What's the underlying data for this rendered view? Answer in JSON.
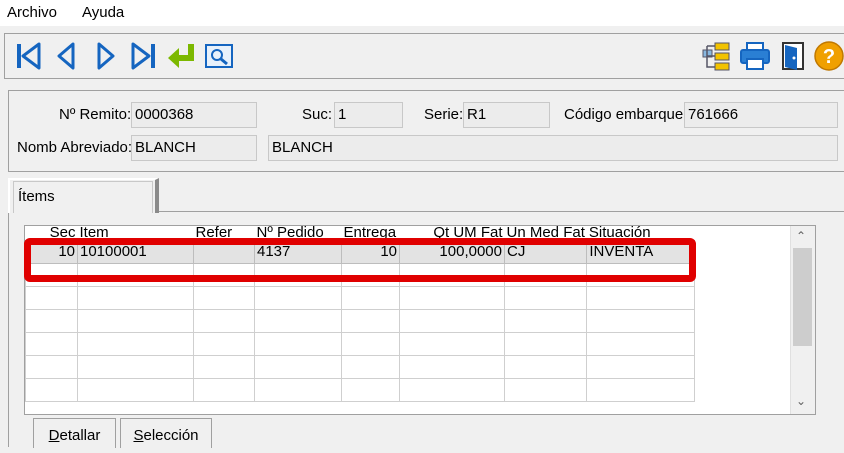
{
  "menu": {
    "archivo": "Archivo",
    "ayuda": "Ayuda"
  },
  "toolbar": {
    "icons": [
      "first-record-icon",
      "previous-record-icon",
      "next-record-icon",
      "last-record-icon",
      "return-icon",
      "preview-icon",
      "tree-icon",
      "print-icon",
      "exit-door-icon",
      "help-icon"
    ],
    "colors": {
      "nav_blue": "#1565c0",
      "return_green": "#7cb800",
      "help_orange": "#f0a000"
    }
  },
  "header": {
    "remito_label": "Nº Remito:",
    "remito_value": "0000368",
    "suc_label": "Suc:",
    "suc_value": "1",
    "serie_label": "Serie:",
    "serie_value": "R1",
    "embarque_label": "Código embarque:",
    "embarque_value": "761666",
    "nomb_label": "Nomb Abreviado:",
    "nomb_value": "BLANCH",
    "nomb_desc": "BLANCH"
  },
  "tabs": [
    {
      "label": "Ítems",
      "selected": true
    }
  ],
  "grid": {
    "columns": [
      "Sec",
      "Ítem",
      "Refer",
      "Nº Pedido",
      "Entrega",
      "Qt UM Fat",
      "Un Med Fat",
      "Situación"
    ],
    "rows": [
      {
        "sec": "10",
        "item": "10100001",
        "refer": "",
        "pedido": "4137",
        "entrega": "10",
        "qt": "100,0000",
        "unmed": "CJ",
        "situacion": "INVENTA"
      }
    ],
    "highlight_color": "#e00000"
  },
  "buttons": {
    "detallar_first": "D",
    "detallar_rest": "etallar",
    "seleccion_first": "S",
    "seleccion_rest": "elección"
  }
}
